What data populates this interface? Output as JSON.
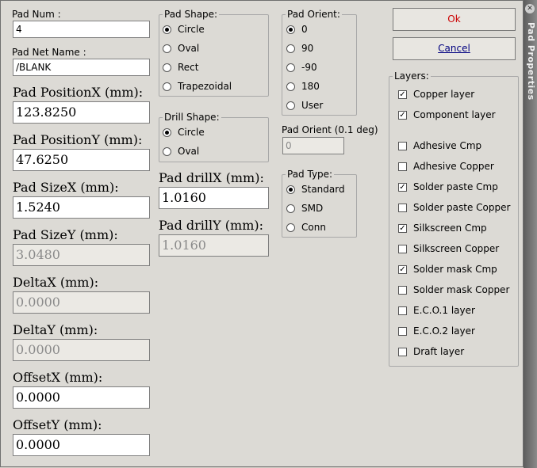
{
  "title": "Pad Properties",
  "fields": {
    "pad_num_label": "Pad Num :",
    "pad_num_value": "4",
    "net_name_label": "Pad Net Name :",
    "net_name_value": "/BLANK",
    "pos_x_label": "Pad PositionX (mm):",
    "pos_x_value": "123.8250",
    "pos_y_label": "Pad PositionY (mm):",
    "pos_y_value": "47.6250",
    "size_x_label": "Pad SizeX (mm):",
    "size_x_value": "1.5240",
    "size_y_label": "Pad SizeY (mm):",
    "size_y_value": "3.0480",
    "delta_x_label": "DeltaX (mm):",
    "delta_x_value": "0.0000",
    "delta_y_label": "DeltaY (mm):",
    "delta_y_value": "0.0000",
    "offset_x_label": "OffsetX (mm):",
    "offset_x_value": "0.0000",
    "offset_y_label": "OffsetY (mm):",
    "offset_y_value": "0.0000",
    "drill_x_label": "Pad drillX (mm):",
    "drill_x_value": "1.0160",
    "drill_y_label": "Pad drillY (mm):",
    "drill_y_value": "1.0160",
    "orient_deg_label": "Pad Orient (0.1 deg)",
    "orient_deg_value": "0"
  },
  "pad_shape": {
    "title": "Pad Shape:",
    "options": [
      "Circle",
      "Oval",
      "Rect",
      "Trapezoidal"
    ],
    "selected": "Circle"
  },
  "drill_shape": {
    "title": "Drill Shape:",
    "options": [
      "Circle",
      "Oval"
    ],
    "selected": "Circle"
  },
  "pad_orient": {
    "title": "Pad Orient:",
    "options": [
      "0",
      "90",
      "-90",
      "180",
      "User"
    ],
    "selected": "0"
  },
  "pad_type": {
    "title": "Pad Type:",
    "options": [
      "Standard",
      "SMD",
      "Conn"
    ],
    "selected": "Standard"
  },
  "buttons": {
    "ok": "Ok",
    "cancel": "Cancel"
  },
  "layers": {
    "title": "Layers:",
    "items": [
      {
        "label": "Copper layer",
        "checked": true
      },
      {
        "label": "Component layer",
        "checked": true
      },
      {
        "label": "Adhesive Cmp",
        "checked": false
      },
      {
        "label": "Adhesive Copper",
        "checked": false
      },
      {
        "label": "Solder paste Cmp",
        "checked": true
      },
      {
        "label": "Solder paste Copper",
        "checked": false
      },
      {
        "label": "Silkscreen Cmp",
        "checked": true
      },
      {
        "label": "Silkscreen Copper",
        "checked": false
      },
      {
        "label": "Solder mask Cmp",
        "checked": true
      },
      {
        "label": "Solder mask Copper",
        "checked": false
      },
      {
        "label": "E.C.O.1 layer",
        "checked": false
      },
      {
        "label": "E.C.O.2 layer",
        "checked": false
      },
      {
        "label": "Draft layer",
        "checked": false
      }
    ]
  },
  "colors": {
    "ok_text": "#cc0000",
    "cancel_text": "#000080"
  }
}
